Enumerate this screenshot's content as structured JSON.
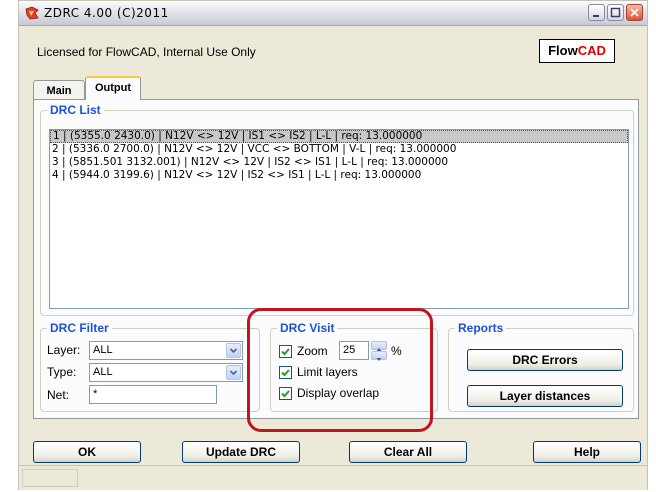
{
  "window": {
    "title": "ZDRC 4.00 (C)2011"
  },
  "header": {
    "license_text": "Licensed for FlowCAD, Internal Use Only",
    "brand_part1": "Flow",
    "brand_part2": "CAD"
  },
  "tabs": [
    {
      "label": "Main",
      "active": false
    },
    {
      "label": "Output",
      "active": true
    }
  ],
  "drc_list": {
    "title": "DRC List",
    "rows": [
      "1 | (5355.0 2430.0) | N12V <> 12V | IS1 <> IS2 | L-L | req: 13.000000",
      "2 | (5336.0 2700.0) | N12V <> 12V | VCC <> BOTTOM | V-L | req: 13.000000",
      "3 | (5851.501 3132.001) | N12V <> 12V | IS2 <> IS1 | L-L | req: 13.000000",
      "4 | (5944.0 3199.6) | N12V <> 12V | IS2 <> IS1 | L-L | req: 13.000000"
    ],
    "selected_index": 0
  },
  "drc_filter": {
    "title": "DRC Filter",
    "layer_label": "Layer:",
    "layer_value": "ALL",
    "type_label": "Type:",
    "type_value": "ALL",
    "net_label": "Net:",
    "net_value": "*"
  },
  "drc_visit": {
    "title": "DRC Visit",
    "zoom_label": "Zoom",
    "zoom_checked": true,
    "zoom_value": "25",
    "zoom_unit": "%",
    "limit_label": "Limit layers",
    "limit_checked": true,
    "overlap_label": "Display overlap",
    "overlap_checked": true
  },
  "reports": {
    "title": "Reports",
    "drc_errors_label": "DRC Errors",
    "layer_distances_label": "Layer distances"
  },
  "footer": {
    "ok_label": "OK",
    "update_label": "Update DRC",
    "clear_label": "Clear All",
    "help_label": "Help"
  },
  "colors": {
    "accent_title": "#1c52d4",
    "brand_red": "#e20000",
    "annotation_ring": "#c0161c"
  },
  "icons": {
    "app": "zdrc-app-icon",
    "minimize": "minimize-icon",
    "maximize": "maximize-icon",
    "close": "close-icon"
  }
}
